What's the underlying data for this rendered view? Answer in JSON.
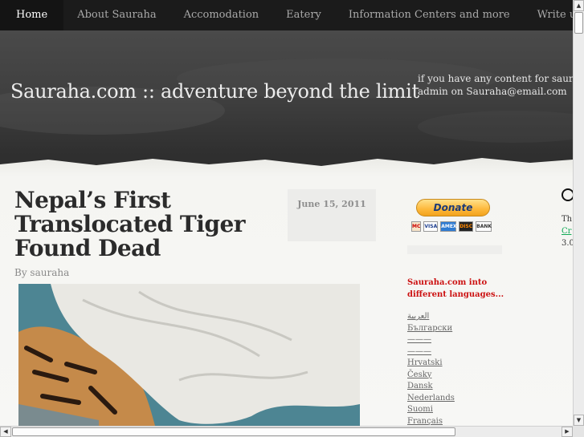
{
  "nav": {
    "items": [
      {
        "label": "Home",
        "active": true
      },
      {
        "label": "About Sauraha",
        "active": false
      },
      {
        "label": "Accomodation",
        "active": false
      },
      {
        "label": "Eatery",
        "active": false
      },
      {
        "label": "Information Centers and more",
        "active": false
      },
      {
        "label": "Write us",
        "active": false
      }
    ]
  },
  "header": {
    "site_title": "Sauraha.com :: adventure beyond the limit",
    "notice_line1": "if you have any content for saura",
    "notice_line2": "admin on Sauraha@email.com"
  },
  "post": {
    "title": "Nepal’s First Translocated Tiger Found Dead",
    "date": "June 15, 2011",
    "author": "By sauraha",
    "image_icon": "sedated-tiger-photo"
  },
  "sidebar": {
    "donate_label": "Donate",
    "payment_cards": [
      "MC",
      "VISA",
      "AMEX",
      "DISC",
      "BANK"
    ],
    "language_heading": "Sauraha.com into different languages...",
    "languages": [
      "العربية",
      "Български",
      "———",
      "———",
      "Hrvatski",
      "Česky",
      "Dansk",
      "Nederlands",
      "Suomi",
      "Français"
    ]
  },
  "right_widget": {
    "line1": "Th",
    "line2": "Cr",
    "line3": "3.0"
  },
  "colors": {
    "nav_bg": "#1b1b1b",
    "header_bg": "#404040",
    "accent_red": "#cc1111",
    "donate_gold": "#fdb83b"
  }
}
